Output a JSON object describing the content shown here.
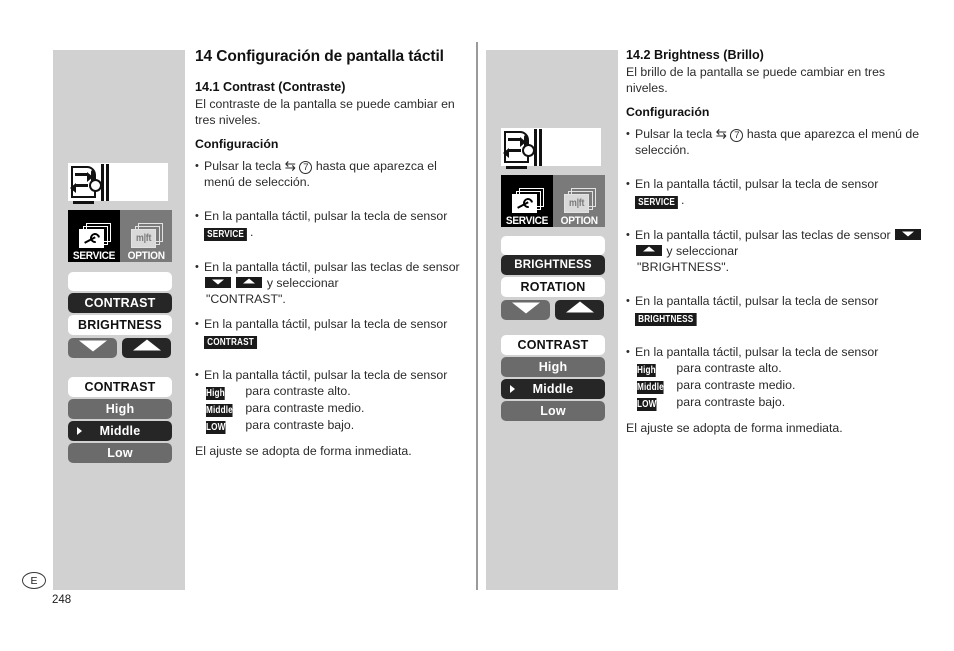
{
  "chapter": {
    "title": "14 Configuración de pantalla táctil"
  },
  "footer": {
    "language_mark": "E",
    "page_number": "248"
  },
  "left_section": {
    "heading": "14.1 Contrast (Contraste)",
    "intro": "El contraste de la pantalla se puede cambiar en tres niveles.",
    "settings_label": "Configuración",
    "steps": [
      {
        "text_before": "Pulsar la tecla",
        "symbol": "⇆",
        "circled": "7",
        "text_after": "hasta que aparezca el menú de selección."
      },
      {
        "text_before": "En la pantalla táctil, pulsar la tecla de sensor",
        "chip": "SERVICE",
        "text_after": "."
      },
      {
        "text_before": "En la pantalla táctil, pulsar las teclas de sensor",
        "arrows": [
          "down",
          "up"
        ],
        "text_mid": "y seleccionar",
        "text_after": "\"CONTRAST\"."
      },
      {
        "text_before": "En la pantalla táctil, pulsar la tecla de sensor",
        "chip": "CONTRAST",
        "text_after": "."
      }
    ],
    "levels_intro": "En la pantalla táctil, pulsar la tecla de sensor",
    "levels": [
      {
        "chip": "High",
        "text": "para contraste alto."
      },
      {
        "chip": "Middle",
        "text": "para contraste medio."
      },
      {
        "chip": "LOW",
        "text": "para contraste bajo."
      }
    ],
    "closing": "El ajuste se adopta de forma inmediata."
  },
  "right_section": {
    "heading": "14.2 Brightness (Brillo)",
    "intro": "El brillo de la pantalla se puede cambiar en tres niveles.",
    "settings_label": "Configuración",
    "steps": [
      {
        "text_before": "Pulsar la tecla",
        "symbol": "⇆",
        "circled": "7",
        "text_after": "hasta que aparezca el menú de selección."
      },
      {
        "text_before": "En la pantalla táctil, pulsar la tecla de sensor",
        "chip": "SERVICE",
        "text_after": "."
      },
      {
        "text_before": "En la pantalla táctil, pulsar las teclas de sensor",
        "arrows": [
          "down",
          "up"
        ],
        "text_mid": "y seleccionar",
        "text_after": "\"BRIGHTNESS\"."
      },
      {
        "text_before": "En la pantalla táctil, pulsar la tecla de sensor",
        "chip": "BRIGHTNESS",
        "text_after": "."
      }
    ],
    "levels_intro": "En la pantalla táctil, pulsar la tecla de sensor",
    "levels": [
      {
        "chip": "High",
        "text": "para contraste alto."
      },
      {
        "chip": "Middle",
        "text": "para contraste medio."
      },
      {
        "chip": "LOW",
        "text": "para contraste bajo."
      }
    ],
    "closing": "El ajuste se adopta de forma inmediata."
  },
  "graphics_left": {
    "tiles": [
      {
        "caption": "SERVICE",
        "icon": "wrench-documents-icon",
        "style": "dark"
      },
      {
        "caption": "OPTION",
        "icon": "mft-documents-icon",
        "style": "gray"
      }
    ],
    "menu": [
      {
        "label": "",
        "style": "white",
        "selected": false
      },
      {
        "label": "CONTRAST",
        "style": "dark",
        "selected": false
      },
      {
        "label": "BRIGHTNESS",
        "style": "white",
        "selected": false
      }
    ],
    "arrow_buttons": [
      {
        "icon": "arrow-down-icon",
        "style": "gray"
      },
      {
        "icon": "arrow-up-icon",
        "style": "dark"
      }
    ],
    "submenu": [
      {
        "label": "CONTRAST",
        "style": "white",
        "selected": false
      },
      {
        "label": "High",
        "style": "gray",
        "selected": false
      },
      {
        "label": "Middle",
        "style": "dark",
        "selected": true
      },
      {
        "label": "Low",
        "style": "gray",
        "selected": false
      }
    ]
  },
  "graphics_right": {
    "tiles": [
      {
        "caption": "SERVICE",
        "icon": "wrench-documents-icon",
        "style": "dark"
      },
      {
        "caption": "OPTION",
        "icon": "mft-documents-icon",
        "style": "gray"
      }
    ],
    "menu": [
      {
        "label": "",
        "style": "white",
        "selected": false
      },
      {
        "label": "BRIGHTNESS",
        "style": "dark",
        "selected": false
      },
      {
        "label": "ROTATION",
        "style": "white",
        "selected": false
      }
    ],
    "arrow_buttons": [
      {
        "icon": "arrow-down-icon",
        "style": "gray"
      },
      {
        "icon": "arrow-up-icon",
        "style": "dark"
      }
    ],
    "submenu": [
      {
        "label": "CONTRAST",
        "style": "white",
        "selected": false
      },
      {
        "label": "High",
        "style": "gray",
        "selected": false
      },
      {
        "label": "Middle",
        "style": "dark",
        "selected": true
      },
      {
        "label": "Low",
        "style": "gray",
        "selected": false
      }
    ]
  },
  "colors": {
    "panel_gray": "#d1d1d1",
    "menu_dark": "#262626",
    "menu_gray": "#6b6b6b",
    "chip_black": "#1a1a1a"
  }
}
